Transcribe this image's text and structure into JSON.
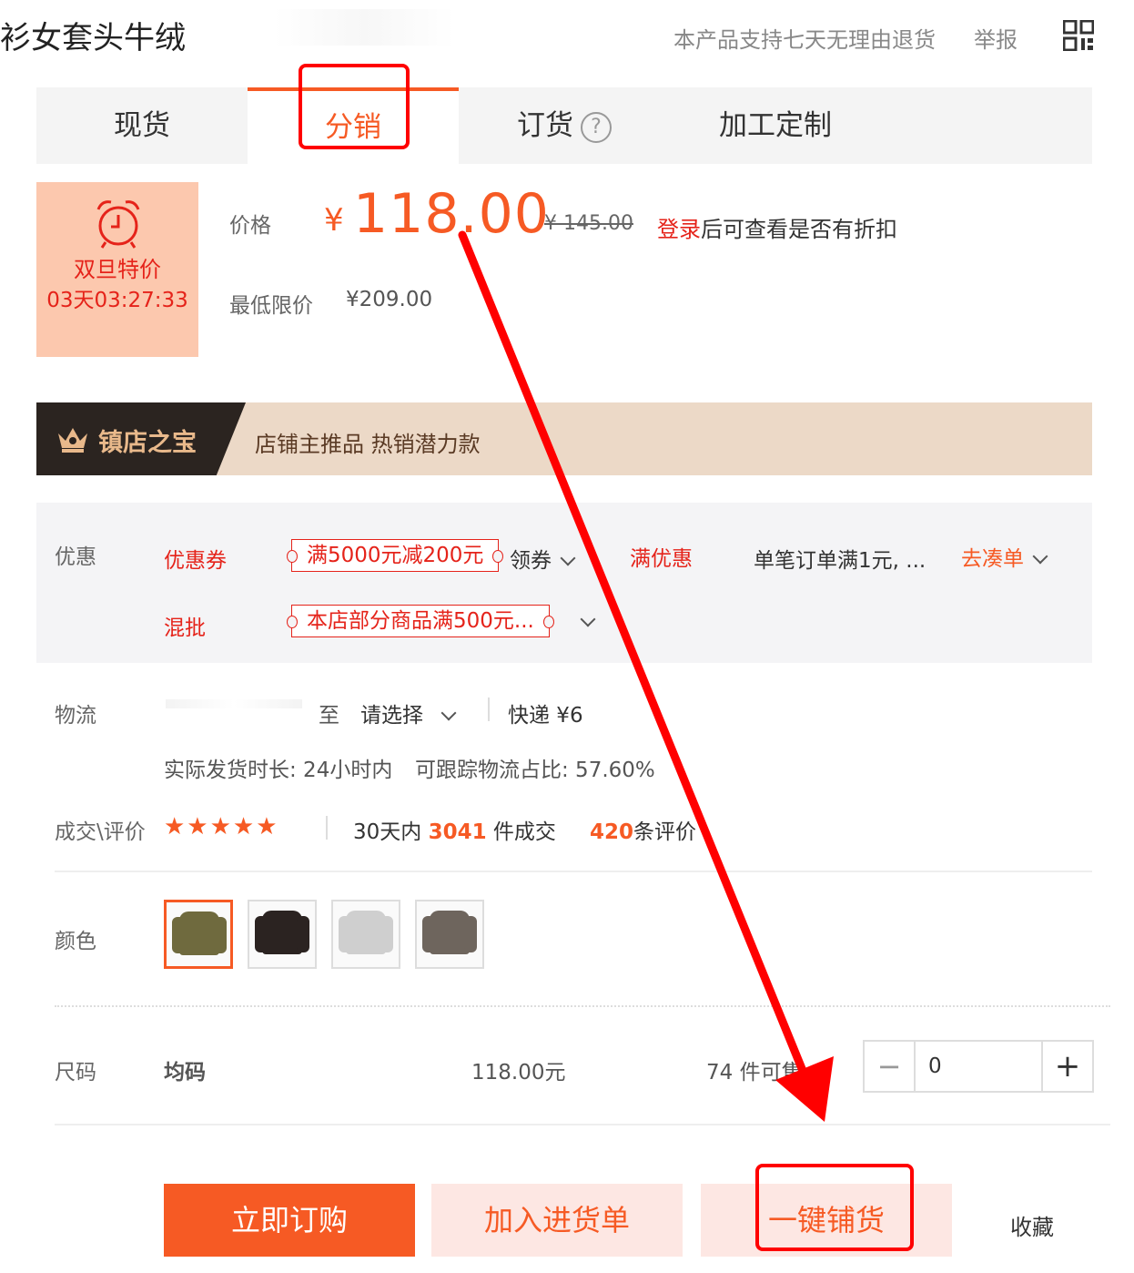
{
  "header": {
    "title_fragment": "衫女套头牛绒",
    "return_policy": "本产品支持七天无理由退货",
    "report": "举报"
  },
  "tabs": [
    {
      "label": "现货"
    },
    {
      "label": "分销"
    },
    {
      "label": "订货"
    },
    {
      "label": "加工定制"
    }
  ],
  "promo": {
    "label": "双旦特价",
    "countdown": "03天03:27:33"
  },
  "price": {
    "label": "价格",
    "currency": "¥",
    "value": "118.00",
    "original": "¥ 145.00",
    "login_link": "登录",
    "login_rest": "后可查看是否有折扣",
    "min_label": "最低限价",
    "min_value": "¥209.00"
  },
  "treasure": {
    "badge": "镇店之宝",
    "slogan": "店铺主推品  热销潜力款"
  },
  "discount": {
    "label": "优惠",
    "coupon_label": "优惠券",
    "coupon_value": "满5000元减200元",
    "claim": "领券",
    "full_label": "满优惠",
    "full_value": "单笔订单满1元, ...",
    "go_collect": "去凑单",
    "mix_label": "混批",
    "mix_value": "本店部分商品满500元..."
  },
  "logistics": {
    "label": "物流",
    "to": "至",
    "select": "请选择",
    "express": "快递 ¥6",
    "ship_time": "实际发货时长: 24小时内",
    "tracking": "可跟踪物流占比: 57.60%"
  },
  "deal": {
    "label": "成交\\评价",
    "stars": "★★★★★",
    "days": "30天内",
    "count": "3041",
    "unit": "件成交",
    "reviews": "420",
    "reviews_unit": "条评价"
  },
  "color": {
    "label": "颜色",
    "swatches": [
      {
        "color": "#6f6a3e",
        "trim": "#e9e1c8"
      },
      {
        "color": "#2b2321",
        "trim": "#9a8f87"
      },
      {
        "color": "#cfcfcf",
        "trim": "#f1f1f1"
      },
      {
        "color": "#6e655d",
        "trim": "#b7ada3"
      }
    ]
  },
  "size": {
    "label": "尺码",
    "value": "均码",
    "price": "118.00元",
    "stock": "74 件可售",
    "qty": "0"
  },
  "actions": {
    "buy": "立即订购",
    "add_cart": "加入进货单",
    "distribute": "一键铺货",
    "favorite": "收藏"
  },
  "colors": {
    "accent": "#f65a24",
    "annotation": "#ff0000"
  }
}
